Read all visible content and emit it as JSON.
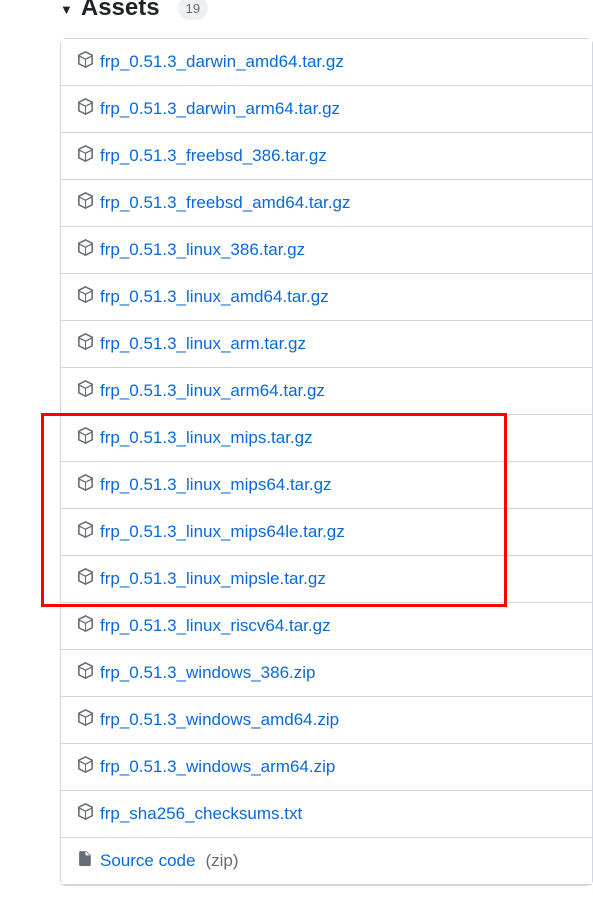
{
  "header": {
    "title": "Assets",
    "count": "19",
    "expanded": true
  },
  "assets": [
    {
      "name": "frp_0.51.3_darwin_amd64.tar.gz",
      "type": "package"
    },
    {
      "name": "frp_0.51.3_darwin_arm64.tar.gz",
      "type": "package"
    },
    {
      "name": "frp_0.51.3_freebsd_386.tar.gz",
      "type": "package"
    },
    {
      "name": "frp_0.51.3_freebsd_amd64.tar.gz",
      "type": "package"
    },
    {
      "name": "frp_0.51.3_linux_386.tar.gz",
      "type": "package"
    },
    {
      "name": "frp_0.51.3_linux_amd64.tar.gz",
      "type": "package"
    },
    {
      "name": "frp_0.51.3_linux_arm.tar.gz",
      "type": "package"
    },
    {
      "name": "frp_0.51.3_linux_arm64.tar.gz",
      "type": "package"
    },
    {
      "name": "frp_0.51.3_linux_mips.tar.gz",
      "type": "package"
    },
    {
      "name": "frp_0.51.3_linux_mips64.tar.gz",
      "type": "package"
    },
    {
      "name": "frp_0.51.3_linux_mips64le.tar.gz",
      "type": "package"
    },
    {
      "name": "frp_0.51.3_linux_mipsle.tar.gz",
      "type": "package"
    },
    {
      "name": "frp_0.51.3_linux_riscv64.tar.gz",
      "type": "package"
    },
    {
      "name": "frp_0.51.3_windows_386.zip",
      "type": "package"
    },
    {
      "name": "frp_0.51.3_windows_amd64.zip",
      "type": "package"
    },
    {
      "name": "frp_0.51.3_windows_arm64.zip",
      "type": "package"
    },
    {
      "name": "frp_sha256_checksums.txt",
      "type": "package"
    },
    {
      "name": "Source code",
      "suffix": "(zip)",
      "type": "zip"
    }
  ],
  "highlight": {
    "start_index": 8,
    "end_index": 11
  }
}
